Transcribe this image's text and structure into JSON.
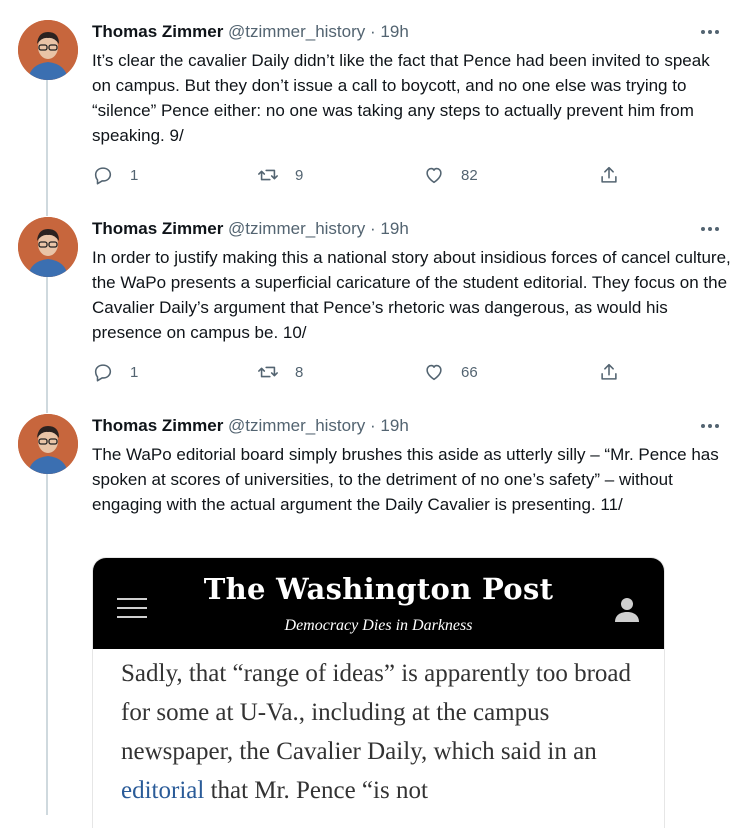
{
  "tweets": [
    {
      "author_name": "Thomas Zimmer",
      "handle": "@tzimmer_history",
      "separator": "·",
      "time": "19h",
      "text": "It’s clear the cavalier Daily didn’t like the fact that Pence had been invited to speak on campus. But they don’t issue a call to boycott, and no one else was trying to “silence” Pence either: no one was taking any steps to actually prevent him from speaking. 9/",
      "replies": "1",
      "retweets": "9",
      "likes": "82"
    },
    {
      "author_name": "Thomas Zimmer",
      "handle": "@tzimmer_history",
      "separator": "·",
      "time": "19h",
      "text": "In order to justify making this a national story about insidious forces of cancel culture, the WaPo presents a superficial caricature of the student editorial. They focus on the Cavalier Daily’s argument that Pence’s rhetoric was dangerous, as would his presence on campus be. 10/",
      "replies": "1",
      "retweets": "8",
      "likes": "66"
    },
    {
      "author_name": "Thomas Zimmer",
      "handle": "@tzimmer_history",
      "separator": "·",
      "time": "19h",
      "text": "The WaPo editorial board simply brushes this aside as utterly silly – “Mr. Pence has spoken at scores of universities, to the detriment of no one’s safety” – without engaging with the actual argument the Daily Cavalier is presenting. 11/"
    }
  ],
  "embed": {
    "masthead": "The Washington Post",
    "tagline": "Democracy Dies in Darkness",
    "article_before_link": "Sadly, that “range of ideas” is apparently too broad for some at U-Va., including at the campus newspaper, the Cavalier Daily, which said in an ",
    "article_link": "editorial",
    "article_after_link": " that Mr. Pence “is not"
  },
  "icons": {
    "more": "more-horizontal-icon",
    "reply": "reply-bubble-icon",
    "retweet": "retweet-icon",
    "like": "heart-icon",
    "share": "share-upload-icon",
    "menu": "hamburger-menu-icon",
    "account": "user-account-icon"
  },
  "colors": {
    "text": "#0f1419",
    "muted": "#536471",
    "thread_line": "#cfd9de",
    "masthead_bg": "#000000",
    "link": "#2a5b98"
  }
}
